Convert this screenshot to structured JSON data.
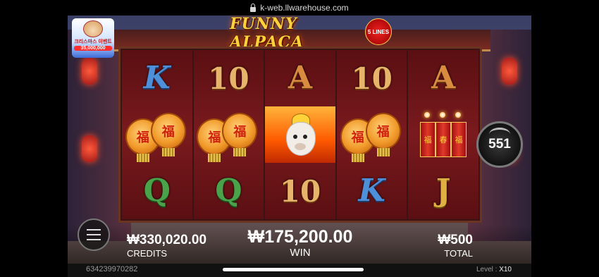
{
  "browser": {
    "url": "k-web.llwarehouse.com"
  },
  "game": {
    "title": "FUNNY ALPACA",
    "lines_badge": "5 LINES",
    "promo": {
      "line1": "크리스마스 이벤트",
      "amount": "35,000,000"
    },
    "reels": [
      [
        "K",
        "lanterns",
        "Q"
      ],
      [
        "10",
        "lanterns",
        "Q"
      ],
      [
        "A",
        "alpaca",
        "10"
      ],
      [
        "10",
        "lanterns",
        "K"
      ],
      [
        "A",
        "firecrackers",
        "J"
      ]
    ],
    "autospin_count": "551",
    "credits_value": "₩330,020.00",
    "credits_label": "CREDITS",
    "win_value": "₩175,200.00",
    "win_label": "WIN",
    "total_value": "₩500",
    "total_label": "TOTAL",
    "session_id": "634239970282",
    "level_label": "Level :",
    "level_value": "X10"
  }
}
